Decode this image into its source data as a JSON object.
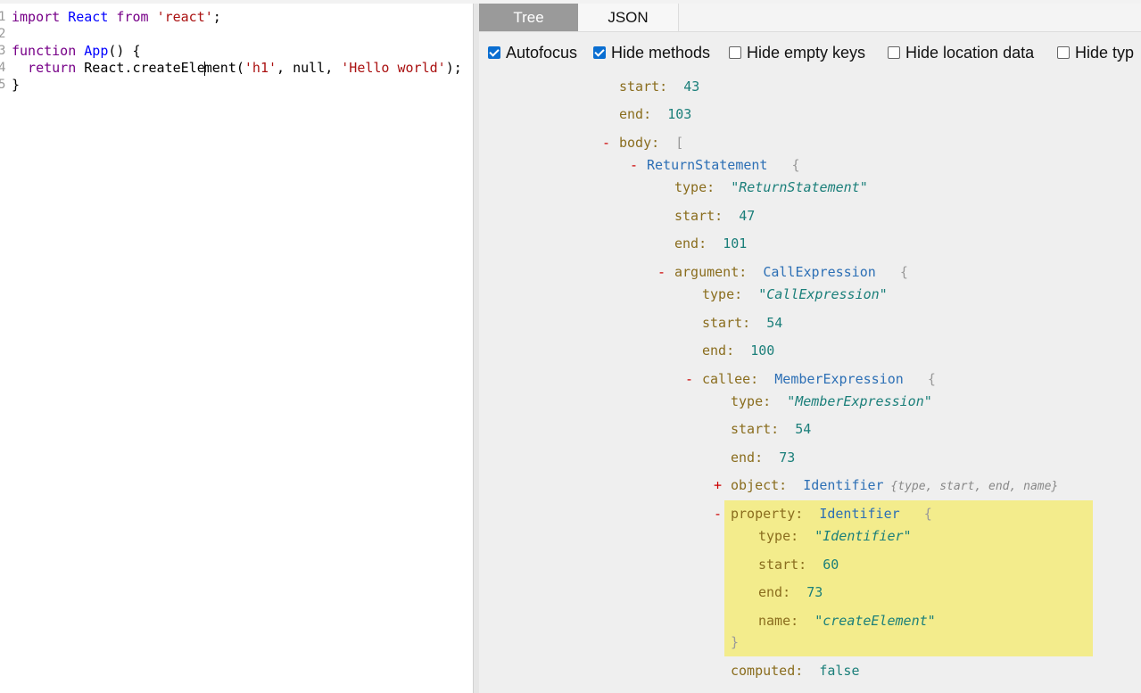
{
  "editor": {
    "lines": [
      {
        "num": "1",
        "tokens": [
          {
            "t": "import ",
            "c": "kw"
          },
          {
            "t": "React ",
            "c": "def"
          },
          {
            "t": "from ",
            "c": "kw"
          },
          {
            "t": "'react'",
            "c": "str"
          },
          {
            "t": ";",
            "c": "plain"
          }
        ]
      },
      {
        "num": "2",
        "tokens": []
      },
      {
        "num": "3",
        "tokens": [
          {
            "t": "function ",
            "c": "kw"
          },
          {
            "t": "App",
            "c": "def"
          },
          {
            "t": "() {",
            "c": "plain"
          }
        ]
      },
      {
        "num": "4",
        "tokens": [
          {
            "t": "  return ",
            "c": "kw"
          },
          {
            "t": "React.createEle",
            "c": "plain"
          },
          {
            "t": "|",
            "c": "cursor"
          },
          {
            "t": "ment(",
            "c": "plain"
          },
          {
            "t": "'h1'",
            "c": "str"
          },
          {
            "t": ", null, ",
            "c": "plain"
          },
          {
            "t": "'Hello world'",
            "c": "str"
          },
          {
            "t": ");",
            "c": "plain"
          }
        ]
      },
      {
        "num": "5",
        "tokens": [
          {
            "t": "}",
            "c": "plain"
          }
        ]
      }
    ]
  },
  "tabs": [
    {
      "label": "Tree",
      "active": true
    },
    {
      "label": "JSON",
      "active": false
    }
  ],
  "options": [
    {
      "label": "Autofocus",
      "checked": true
    },
    {
      "label": "Hide methods",
      "checked": true
    },
    {
      "label": "Hide empty keys",
      "checked": false
    },
    {
      "label": "Hide location data",
      "checked": false
    },
    {
      "label": "Hide typ",
      "checked": false
    }
  ],
  "tree": [
    {
      "key": "start:",
      "val": "43",
      "vtype": "n"
    },
    {
      "key": "end:",
      "val": "103",
      "vtype": "n"
    },
    {
      "toggle": "-",
      "key": "body:",
      "val": "[",
      "vtype": "b"
    },
    {
      "toggle": "-",
      "key": "",
      "val": "ReturnStatement",
      "vtype": "t",
      "brace": "{"
    },
    {
      "key": "type:",
      "val": "\"ReturnStatement\"",
      "vtype": "s"
    },
    {
      "key": "start:",
      "val": "47",
      "vtype": "n"
    },
    {
      "key": "end:",
      "val": "101",
      "vtype": "n"
    },
    {
      "toggle": "-",
      "key": "argument:",
      "val": "CallExpression",
      "vtype": "t",
      "brace": "{"
    },
    {
      "key": "type:",
      "val": "\"CallExpression\"",
      "vtype": "s"
    },
    {
      "key": "start:",
      "val": "54",
      "vtype": "n"
    },
    {
      "key": "end:",
      "val": "100",
      "vtype": "n"
    },
    {
      "toggle": "-",
      "key": "callee:",
      "val": "MemberExpression",
      "vtype": "t",
      "brace": "{"
    },
    {
      "key": "type:",
      "val": "\"MemberExpression\"",
      "vtype": "s"
    },
    {
      "key": "start:",
      "val": "54",
      "vtype": "n"
    },
    {
      "key": "end:",
      "val": "73",
      "vtype": "n"
    },
    {
      "toggle": "+",
      "key": "object:",
      "val": "Identifier",
      "vtype": "t",
      "summary": "{type, start, end, name}"
    },
    {
      "toggle": "-",
      "key": "property:",
      "val": "Identifier",
      "vtype": "t",
      "brace": "{"
    },
    {
      "key": "type:",
      "val": "\"Identifier\"",
      "vtype": "s"
    },
    {
      "key": "start:",
      "val": "60",
      "vtype": "n"
    },
    {
      "key": "end:",
      "val": "73",
      "vtype": "n"
    },
    {
      "key": "name:",
      "val": "\"createElement\"",
      "vtype": "s"
    },
    {
      "key": "",
      "val": "}",
      "vtype": "b"
    },
    {
      "key": "computed:",
      "val": "false",
      "vtype": "n"
    }
  ]
}
